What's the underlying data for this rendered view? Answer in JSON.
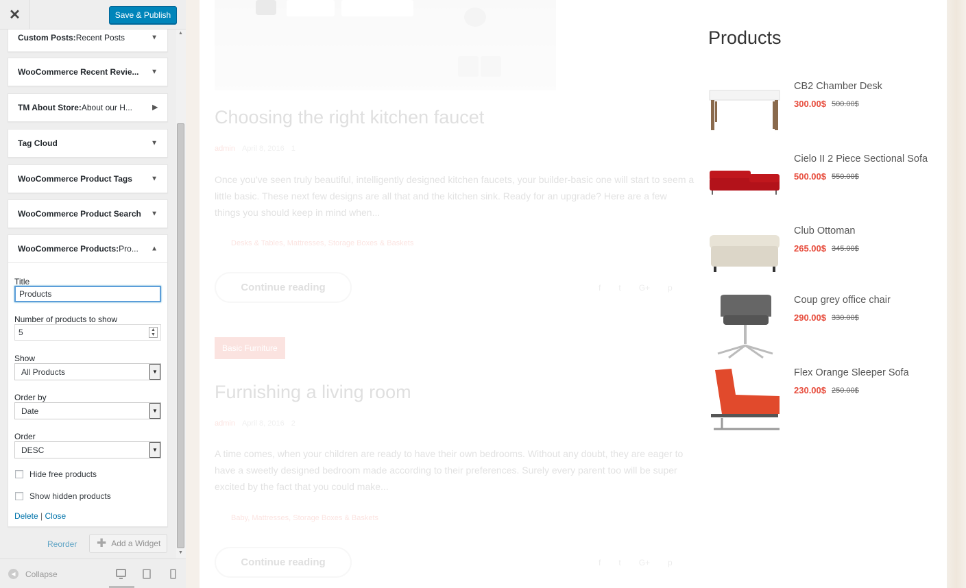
{
  "header": {
    "close_label": "✕",
    "publish_label": "Save & Publish"
  },
  "widgets": [
    {
      "name": "Custom Posts:",
      "sub": " Recent Posts"
    },
    {
      "name": "WooCommerce Recent Revie...",
      "sub": ""
    },
    {
      "name": "TM About Store:",
      "sub": " About our H..."
    },
    {
      "name": "Tag Cloud",
      "sub": ""
    },
    {
      "name": "WooCommerce Product Tags",
      "sub": ""
    },
    {
      "name": "WooCommerce Product Search",
      "sub": ""
    },
    {
      "name": "WooCommerce Products:",
      "sub": " Pro..."
    }
  ],
  "form": {
    "title_label": "Title",
    "title_value": "Products",
    "number_label": "Number of products to show",
    "number_value": "5",
    "show_label": "Show",
    "show_value": "All Products",
    "orderby_label": "Order by",
    "orderby_value": "Date",
    "order_label": "Order",
    "order_value": "DESC",
    "hide_free_label": "Hide free products",
    "show_hidden_label": "Show hidden products",
    "delete_label": "Delete",
    "close_label": "Close"
  },
  "actions": {
    "reorder_label": "Reorder",
    "add_widget_label": "Add a Widget"
  },
  "footer": {
    "collapse_label": "Collapse"
  },
  "posts": [
    {
      "title": "Choosing the right kitchen faucet",
      "author": "admin",
      "date": "April 8, 2016",
      "comments": "1",
      "excerpt": "Once you've seen truly beautiful, intelligently designed kitchen faucets, your builder-basic one will start to seem a little basic. These next few designs are all that and the kitchen sink. Ready for an upgrade? Here are a few things you should keep in mind when...",
      "tags": "Desks & Tables, Mattresses, Storage Boxes & Baskets",
      "button": "Continue reading"
    },
    {
      "category": "Basic Furniture",
      "title": "Furnishing a living room",
      "author": "admin",
      "date": "April 8, 2016",
      "comments": "2",
      "excerpt": "A time comes, when your children are ready to have their own bedrooms. Without any doubt, they are eager to have a sweetly designed bedroom made according to their preferences. Surely every parent too will be super excited by the fact that you could make...",
      "tags": "Baby, Mattresses, Storage Boxes & Baskets",
      "button": "Continue reading"
    }
  ],
  "share_icons": [
    "facebook-icon",
    "twitter-icon",
    "google-plus-icon",
    "pinterest-icon"
  ],
  "products_widget": {
    "title": "Products",
    "items": [
      {
        "name": "CB2 Chamber Desk",
        "price": "300.00$",
        "old_price": "500.00$"
      },
      {
        "name": "Cielo II 2 Piece Sectional Sofa",
        "price": "500.00$",
        "old_price": "550.00$"
      },
      {
        "name": "Club Ottoman",
        "price": "265.00$",
        "old_price": "345.00$"
      },
      {
        "name": "Coup grey office chair",
        "price": "290.00$",
        "old_price": "330.00$"
      },
      {
        "name": "Flex Orange Sleeper Sofa",
        "price": "230.00$",
        "old_price": "250.00$"
      }
    ]
  },
  "colors": {
    "accent": "#e74c3c",
    "publish": "#0085ba",
    "link": "#0073aa"
  }
}
